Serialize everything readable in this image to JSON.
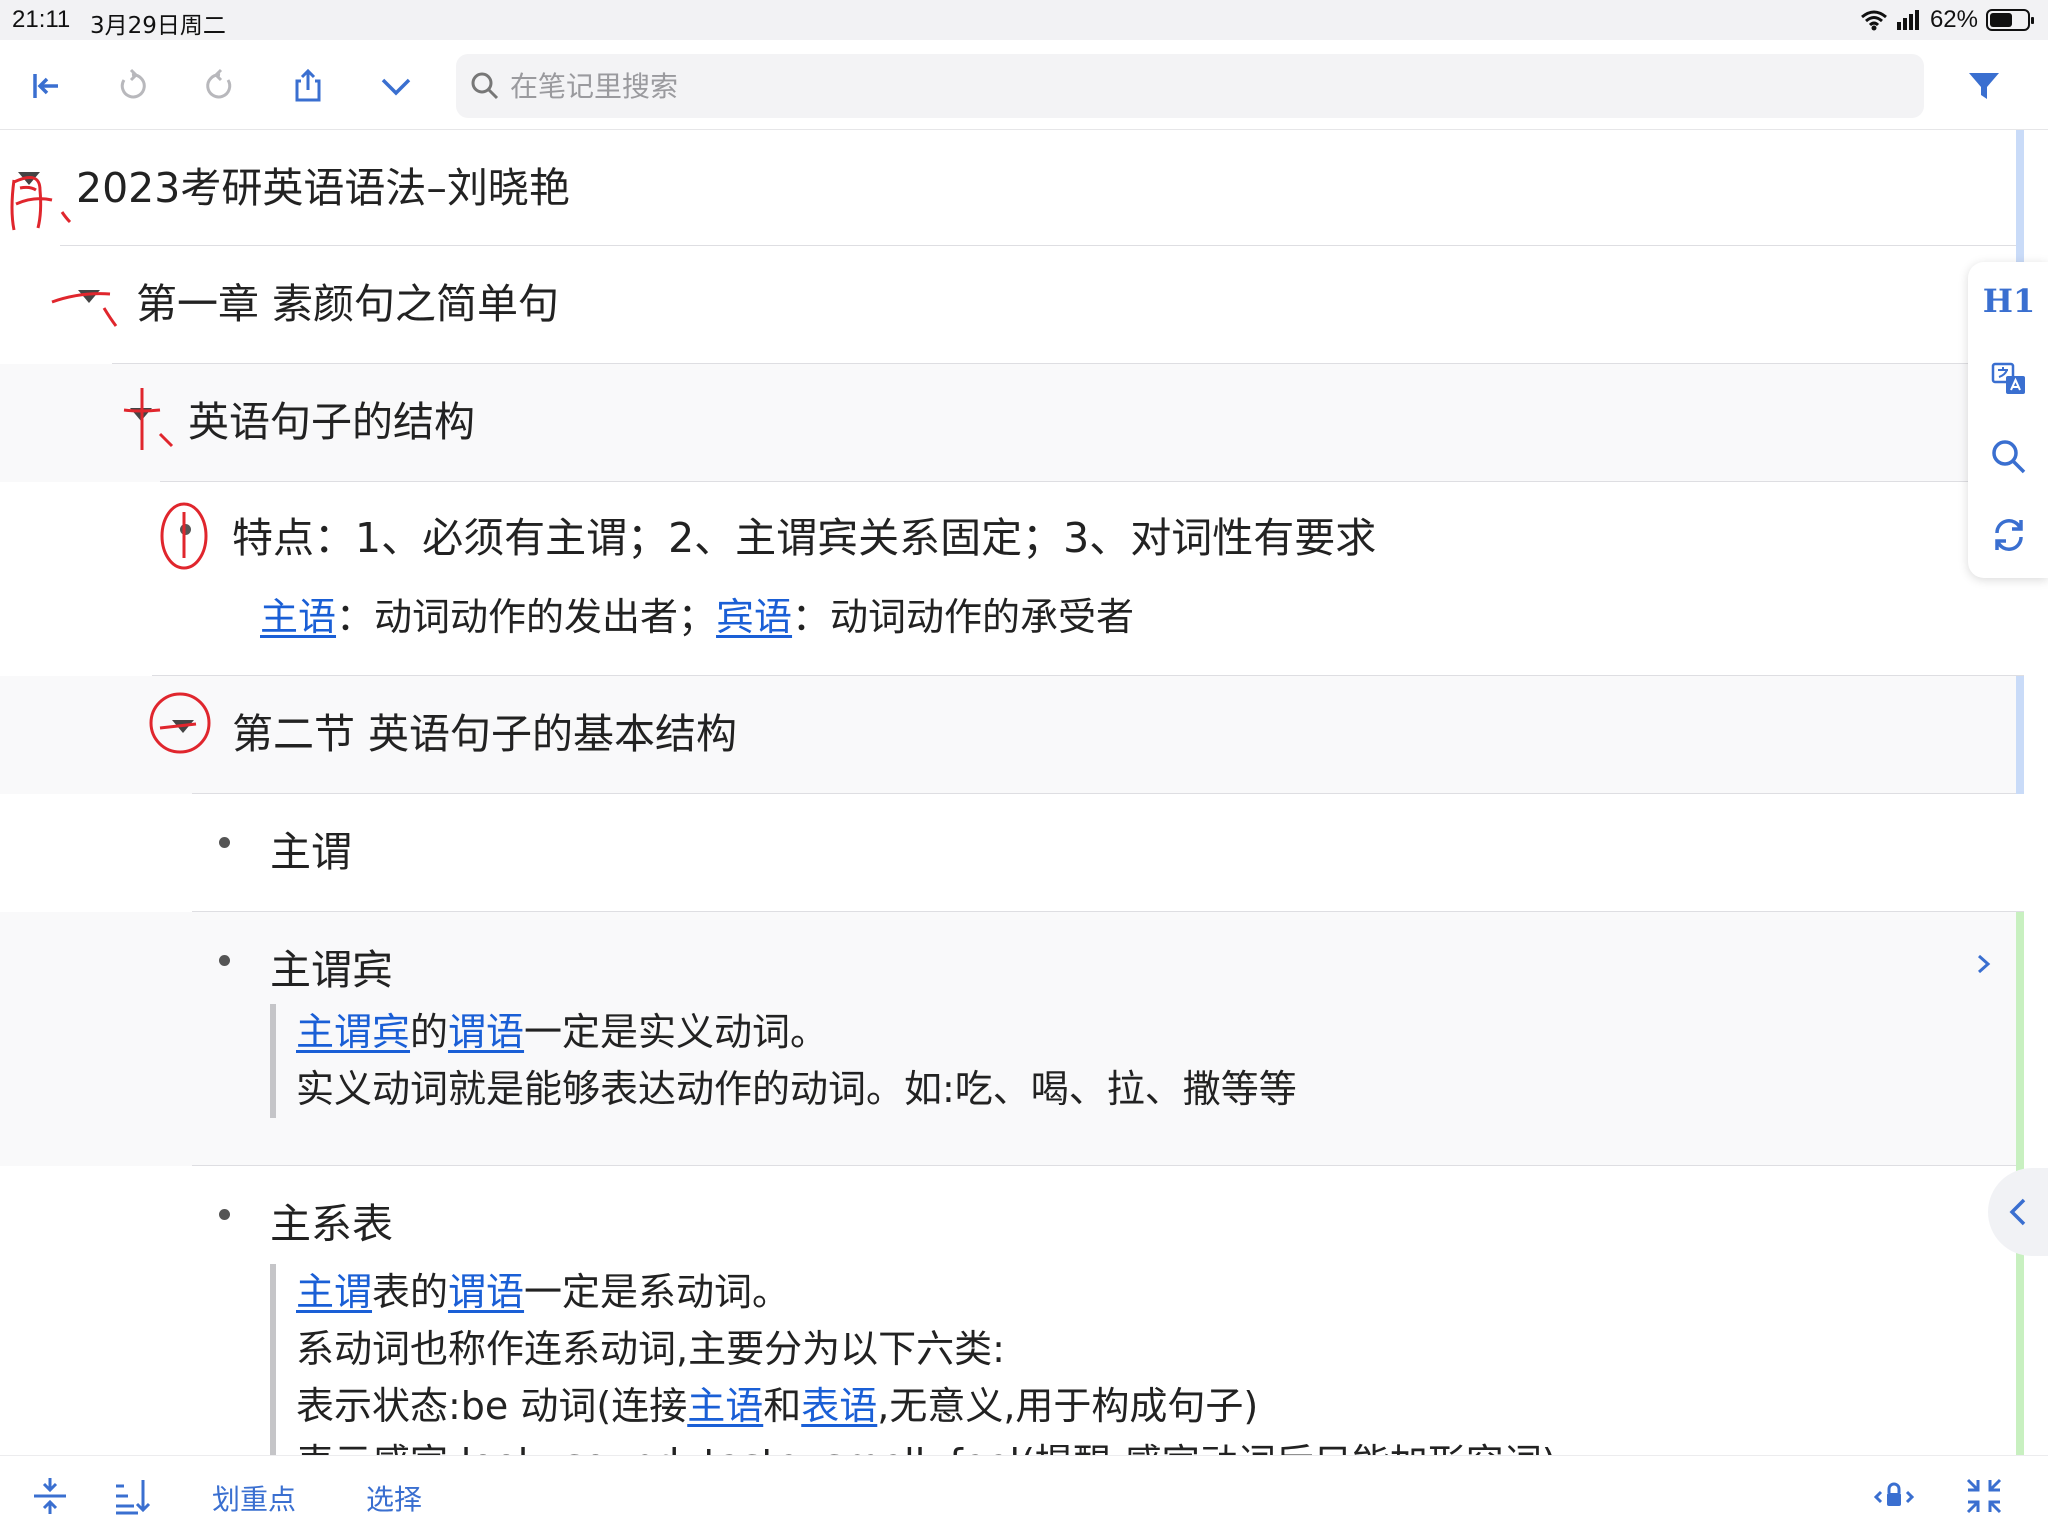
{
  "status_bar": {
    "time": "21:11",
    "date": "3月29日周二",
    "battery": "62%",
    "battery_level": 0.62
  },
  "toolbar": {
    "search_placeholder": "在笔记里搜索",
    "icons": [
      "collapse-sidebar-icon",
      "undo-icon",
      "redo-icon",
      "share-icon",
      "chevron-down-icon",
      "search-icon",
      "filter-icon"
    ]
  },
  "outline": {
    "title": "2023考研英语语法–刘晓艳",
    "chapter": "第一章  素颜句之简单句",
    "section1": {
      "title": "英语句子的结构",
      "feature": "特点：1、必须有主谓；2、主谓宾关系固定；3、对词性有要求",
      "note": {
        "link1": "主语",
        "text1": "：动词动作的发出者；",
        "link2": "宾语",
        "text2": "：动词动作的承受者"
      }
    },
    "section2": {
      "title": "第二节  英语句子的基本结构",
      "items": [
        {
          "label": "主谓"
        },
        {
          "label": "主谓宾",
          "line1_link1": "主谓宾",
          "line1_text1": "的",
          "line1_link2": "谓语",
          "line1_text2": "一定是实义动词。",
          "line2": "实义动词就是能够表达动作的动词。如:吃、喝、拉、撒等等"
        },
        {
          "label": "主系表",
          "line1_link1": "主谓",
          "line1_text1": "表的",
          "line1_link2": "谓语",
          "line1_text2": "一定是系动词。",
          "line2": "系动词也称作连系动词,主要分为以下六类:",
          "line3_text1": "表示状态:be 动词(连接",
          "line3_link1": "主语",
          "line3_text2": "和",
          "line3_link2": "表语",
          "line3_text3": ",无意义,用于构成句子)",
          "line4": "表示感官:look, sound, taste, smell, feel(提醒:感官动词后只能加形容词)"
        }
      ]
    }
  },
  "side_panel": {
    "h1_label": "H1",
    "icons": [
      "heading-icon",
      "translate-icon",
      "search-icon",
      "sync-icon",
      "collapse-panel-icon"
    ]
  },
  "bottom_bar": {
    "highlight_label": "划重点",
    "select_label": "选择",
    "icons": [
      "expand-collapse-icon",
      "sort-icon",
      "lock-icon",
      "fullscreen-exit-icon"
    ]
  },
  "colors": {
    "accent": "#3a6fd0",
    "link": "#1a5fd6",
    "annotation_red": "#e0262d",
    "selection_blue": "#c9dbf8",
    "selection_green": "#c8f0c0"
  }
}
